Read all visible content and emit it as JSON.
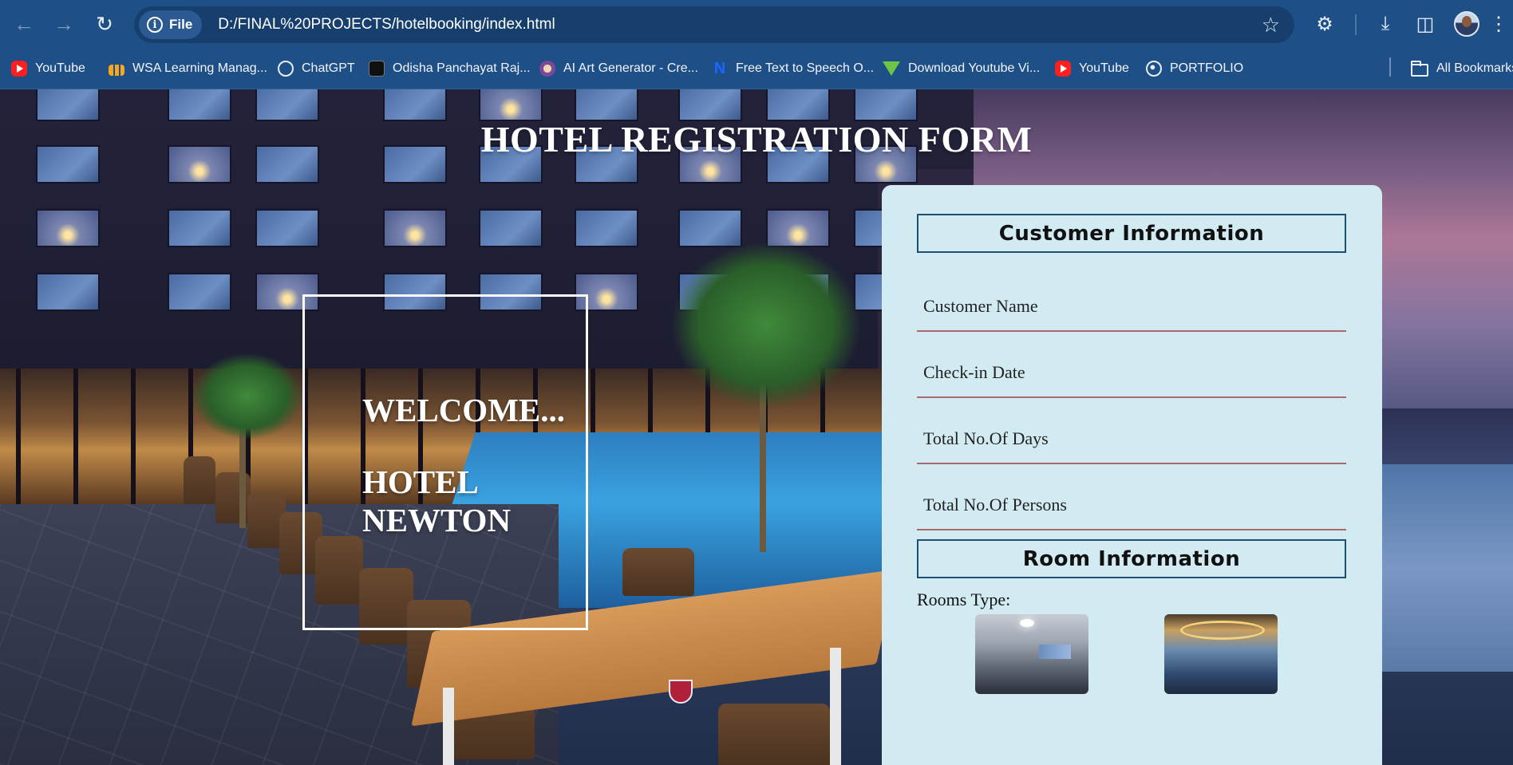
{
  "browser": {
    "site_chip": "File",
    "url": "D:/FINAL%20PROJECTS/hotelbooking/index.html",
    "bookmarks": [
      {
        "label": "YouTube",
        "icon": "youtube-icon"
      },
      {
        "label": "WSA Learning Manag...",
        "icon": "wsa-icon"
      },
      {
        "label": "ChatGPT",
        "icon": "chatgpt-icon"
      },
      {
        "label": "Odisha Panchayat Raj...",
        "icon": "odisha-icon"
      },
      {
        "label": "AI Art Generator - Cre...",
        "icon": "ai-art-icon"
      },
      {
        "label": "Free Text to Speech O...",
        "icon": "tts-icon"
      },
      {
        "label": "Download Youtube Vi...",
        "icon": "download-arrow-icon"
      },
      {
        "label": "YouTube",
        "icon": "youtube-icon"
      },
      {
        "label": "PORTFOLIO",
        "icon": "globe-icon"
      }
    ],
    "all_bookmarks": "All Bookmarks"
  },
  "page": {
    "title": "HOTEL REGISTRATION FORM",
    "welcome": "WELCOME...",
    "hotel_name_line1": "HOTEL",
    "hotel_name_line2": "NEWTON"
  },
  "form": {
    "customer_section": "Customer Information",
    "fields": [
      {
        "placeholder": "Customer Name",
        "value": ""
      },
      {
        "placeholder": "Check-in Date",
        "value": ""
      },
      {
        "placeholder": "Total No.Of Days",
        "value": ""
      },
      {
        "placeholder": "Total No.Of Persons",
        "value": ""
      }
    ],
    "room_section": "Room Information",
    "rooms_label": "Rooms Type:"
  },
  "colors": {
    "chrome": "#1e4f86",
    "form_bg": "#d2ebf2",
    "section_border": "#1f4f6e",
    "field_underline": "#a86a6a"
  }
}
